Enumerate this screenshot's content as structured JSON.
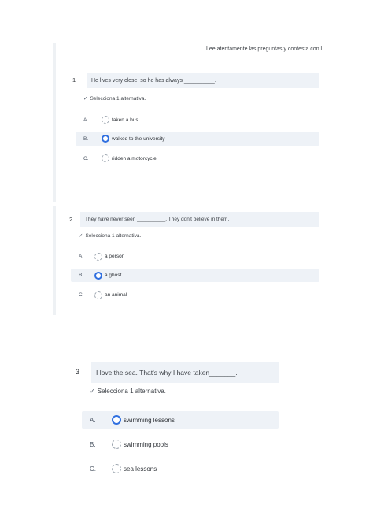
{
  "header": {
    "instructions": "Lee atentamente las preguntas y contesta con l"
  },
  "instruction_text": "Selecciona 1 alternativa.",
  "questions": [
    {
      "number": "1",
      "stem": "He lives very close, so he has always __________.",
      "options": [
        {
          "letter": "A.",
          "label": "taken a bus",
          "selected": false
        },
        {
          "letter": "B.",
          "label": "walked to the university",
          "selected": true
        },
        {
          "letter": "C.",
          "label": "ridden a motorcycle",
          "selected": false
        }
      ]
    },
    {
      "number": "2",
      "stem": "They have never seen __________. They don't believe in them.",
      "options": [
        {
          "letter": "A.",
          "label": "a person",
          "selected": false
        },
        {
          "letter": "B.",
          "label": "a ghost",
          "selected": true
        },
        {
          "letter": "C.",
          "label": "an animal",
          "selected": false
        }
      ]
    },
    {
      "number": "3",
      "stem": "I love the sea. That's why I have taken_______.",
      "options": [
        {
          "letter": "A.",
          "label": "swimming lessons",
          "selected": true
        },
        {
          "letter": "B.",
          "label": "swimming pools",
          "selected": false
        },
        {
          "letter": "C.",
          "label": "sea lessons",
          "selected": false
        }
      ]
    }
  ],
  "colors": {
    "accent": "#2f6fe0",
    "stem_background": "#eef2f7"
  }
}
